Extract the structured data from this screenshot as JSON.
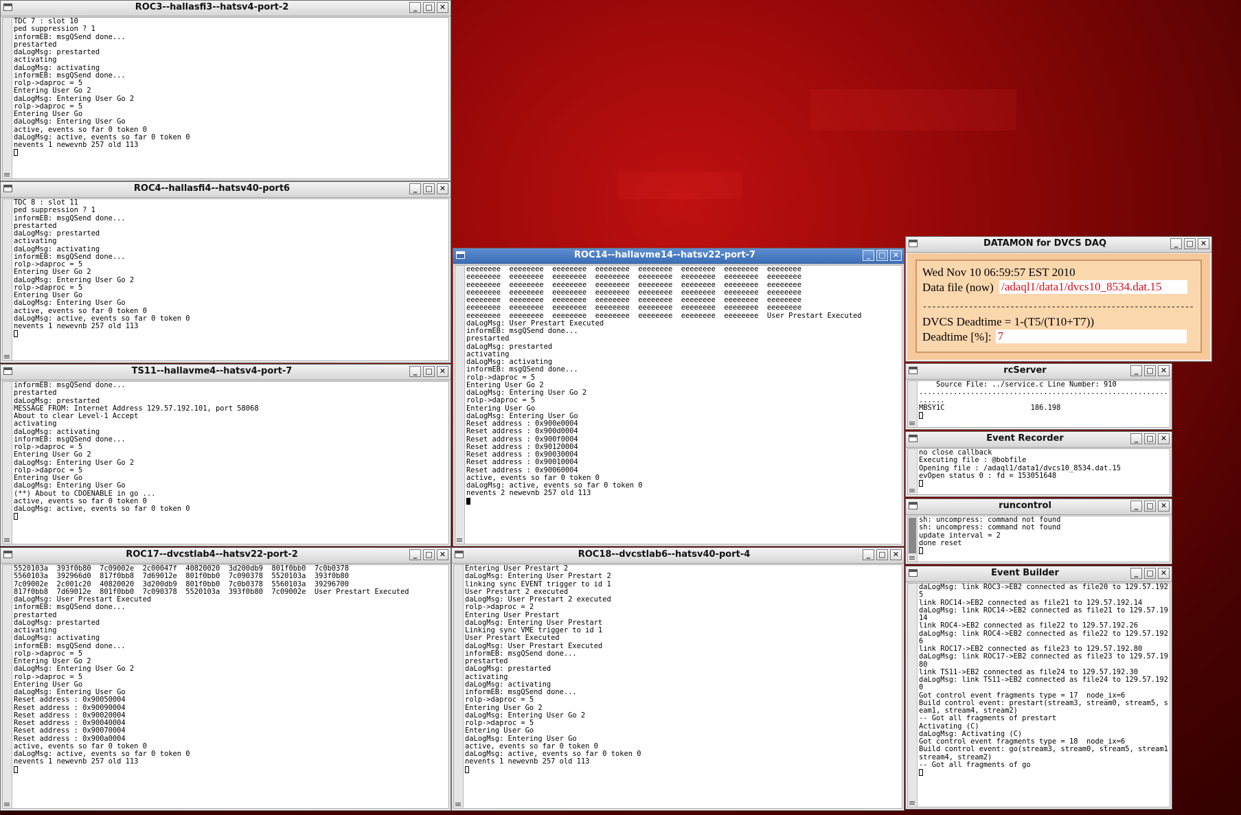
{
  "windows": {
    "roc3": {
      "title": "ROC3--hallasfi3--hatsv4-port-2",
      "lines": [
        "TDC 7 : slot 10",
        "ped suppression ? 1",
        "informEB: msgQSend done...",
        "prestarted",
        "daLogMsg: prestarted",
        "activating",
        "daLogMsg: activating",
        "informEB: msgQSend done...",
        "rolp->daproc = 5",
        "Entering User Go 2",
        "daLogMsg: Entering User Go 2",
        "rolp->daproc = 5",
        "Entering User Go",
        "daLogMsg: Entering User Go",
        "active, events so far 0 token 0",
        "daLogMsg: active, events so far 0 token 0",
        "nevents 1 newevnb 257 old 113"
      ]
    },
    "roc4": {
      "title": "ROC4--hallasfi4--hatsv40-port6",
      "lines": [
        "TDC 8 : slot 11",
        "ped suppression ? 1",
        "informEB: msgQSend done...",
        "prestarted",
        "daLogMsg: prestarted",
        "activating",
        "daLogMsg: activating",
        "informEB: msgQSend done...",
        "rolp->daproc = 5",
        "Entering User Go 2",
        "daLogMsg: Entering User Go 2",
        "rolp->daproc = 5",
        "Entering User Go",
        "daLogMsg: Entering User Go",
        "active, events so far 0 token 0",
        "daLogMsg: active, events so far 0 token 0",
        "nevents 1 newevnb 257 old 113"
      ]
    },
    "ts11": {
      "title": "TS11--hallavme4--hatsv4-port-7",
      "lines": [
        "informEB: msgQSend done...",
        "prestarted",
        "daLogMsg: prestarted",
        "MESSAGE FROM: Internet Address 129.57.192.101, port 58068",
        "About to clear Level-1 Accept",
        "activating",
        "daLogMsg: activating",
        "informEB: msgQSend done...",
        "rolp->daproc = 5",
        "Entering User Go 2",
        "daLogMsg: Entering User Go 2",
        "rolp->daproc = 5",
        "Entering User Go",
        "daLogMsg: Entering User Go",
        "(**) About to CDOENABLE in go ...",
        "active, events so far 0 token 0",
        "daLogMsg: active, events so far 0 token 0"
      ]
    },
    "roc17": {
      "title": "ROC17--dvcstlab4--hatsv22-port-2",
      "lines": [
        "5520103a  393f0b80  7c09002e  2c00047f  40820020  3d200db9  801f0bb0  7c0b0378",
        "5560103a  392966d0  817f0bb8  7d69012e  801f0bb0  7c090378  5520103a  393f0b80",
        "7c09002e  2c001c20  40820020  3d200db9  801f0bb0  7c0b0378  5560103a  39296700",
        "817f0bb8  7d69012e  801f0bb0  7c090378  5520103a  393f0b80  7c09002e  User Prestart Executed",
        "daLogMsg: User Prestart Executed",
        "informEB: msgQSend done...",
        "prestarted",
        "daLogMsg: prestarted",
        "activating",
        "daLogMsg: activating",
        "informEB: msgQSend done...",
        "rolp->daproc = 5",
        "Entering User Go 2",
        "daLogMsg: Entering User Go 2",
        "rolp->daproc = 5",
        "Entering User Go",
        "daLogMsg: Entering User Go",
        "Reset address : 0x90050004",
        "Reset address : 0x90090004",
        "Reset address : 0x90020004",
        "Reset address : 0x90040004",
        "Reset address : 0x90070004",
        "Reset address : 0x900a0004",
        "active, events so far 0 token 0",
        "daLogMsg: active, events so far 0 token 0",
        "nevents 1 newevnb 257 old 113"
      ]
    },
    "roc14": {
      "title": "ROC14--hallavme14--hatsv22-port-7",
      "lines": [
        "eeeeeeee  eeeeeeee  eeeeeeee  eeeeeeee  eeeeeeee  eeeeeeee  eeeeeeee  eeeeeeee",
        "eeeeeeee  eeeeeeee  eeeeeeee  eeeeeeee  eeeeeeee  eeeeeeee  eeeeeeee  eeeeeeee",
        "eeeeeeee  eeeeeeee  eeeeeeee  eeeeeeee  eeeeeeee  eeeeeeee  eeeeeeee  eeeeeeee",
        "eeeeeeee  eeeeeeee  eeeeeeee  eeeeeeee  eeeeeeee  eeeeeeee  eeeeeeee  eeeeeeee",
        "eeeeeeee  eeeeeeee  eeeeeeee  eeeeeeee  eeeeeeee  eeeeeeee  eeeeeeee  eeeeeeee",
        "eeeeeeee  eeeeeeee  eeeeeeee  eeeeeeee  eeeeeeee  eeeeeeee  eeeeeeee  eeeeeeee",
        "eeeeeeee  eeeeeeee  eeeeeeee  eeeeeeee  eeeeeeee  eeeeeeee  eeeeeeee  User Prestart Executed",
        "daLogMsg: User Prestart Executed",
        "informEB: msgQSend done...",
        "prestarted",
        "daLogMsg: prestarted",
        "activating",
        "daLogMsg: activating",
        "informEB: msgQSend done...",
        "rolp->daproc = 5",
        "Entering User Go 2",
        "daLogMsg: Entering User Go 2",
        "rolp->daproc = 5",
        "Entering User Go",
        "daLogMsg: Entering User Go",
        "Reset address : 0x900e0004",
        "Reset address : 0x900d0004",
        "Reset address : 0x900f0004",
        "Reset address : 0x90120004",
        "Reset address : 0x90030004",
        "Reset address : 0x90010004",
        "Reset address : 0x90060004",
        "active, events so far 0 token 0",
        "daLogMsg: active, events so far 0 token 0",
        "nevents 2 newevnb 257 old 113"
      ]
    },
    "roc18": {
      "title": "ROC18--dvcstlab6--hatsv40-port-4",
      "lines": [
        "Entering User Prestart 2",
        "daLogMsg: Entering User Prestart 2",
        "linking sync EVENT trigger to id 1",
        "User Prestart 2 executed",
        "daLogMsg: User Prestart 2 executed",
        "rolp->daproc = 2",
        "Entering User Prestart",
        "daLogMsg: Entering User Prestart",
        "Linking sync VME trigger to id 1",
        "User Prestart Executed",
        "daLogMsg: User Prestart Executed",
        "informEB: msgQSend done...",
        "prestarted",
        "daLogMsg: prestarted",
        "activating",
        "daLogMsg: activating",
        "informEB: msgQSend done...",
        "rolp->daproc = 5",
        "Entering User Go 2",
        "daLogMsg: Entering User Go 2",
        "rolp->daproc = 5",
        "Entering User Go",
        "daLogMsg: Entering User Go",
        "active, events so far 0 token 0",
        "daLogMsg: active, events so far 0 token 0",
        "nevents 1 newevnb 257 old 113"
      ]
    },
    "datamon": {
      "title": "DATAMON  for DVCS DAQ",
      "date": "Wed Nov 10 06:59:57 EST 2010",
      "datafile_label": "Data file (now)",
      "datafile_value": "/adaql1/data1/dvcs10_8534.dat.15",
      "separator": "--------------------------------------------------------------------------",
      "deadtime_formula": "DVCS Deadtime = 1-(T5/(T10+T7))",
      "deadtime_label": "Deadtime [%]:",
      "deadtime_value": "7"
    },
    "rcserver": {
      "title": "rcServer",
      "lines": [
        "    Source File: ../service.c Line Number: 910",
        "...................................................................",
        "......",
        "MBSY1C                    186.198"
      ]
    },
    "eventrecorder": {
      "title": "Event Recorder",
      "lines": [
        "no close callback",
        "Executing file : @bobfile",
        "Opening file : /adaql1/data1/dvcs10_8534.dat.15",
        "evOpen status 0 : fd = 153051648"
      ]
    },
    "runcontrol": {
      "title": "runcontrol",
      "lines": [
        "sh: uncompress: command not found",
        "sh: uncompress: command not found",
        "update interval = 2",
        "done reset"
      ]
    },
    "eventbuilder": {
      "title": "Event Builder",
      "lines": [
        "daLogMsg: link ROC3->EB2 connected as file20 to 129.57.192.2",
        "5",
        "link ROC14->EB2 connected as file21 to 129.57.192.14",
        "daLogMsg: link ROC14->EB2 connected as file21 to 129.57.192.",
        "14",
        "link ROC4->EB2 connected as file22 to 129.57.192.26",
        "daLogMsg: link ROC4->EB2 connected as file22 to 129.57.192.2",
        "6",
        "link ROC17->EB2 connected as file23 to 129.57.192.80",
        "daLogMsg: link ROC17->EB2 connected as file23 to 129.57.192.",
        "80",
        "link TS11->EB2 connected as file24 to 129.57.192.30",
        "daLogMsg: link TS11->EB2 connected as file24 to 129.57.192.3",
        "0",
        "Got control event fragments type = 17  node_ix=6",
        "Build control event: prestart(stream3, stream0, stream5, str",
        "eam1, stream4, stream2)",
        "-- Got all fragments of prestart",
        "Activating (C)",
        "daLogMsg: Activating (C)",
        "Got control event fragments type = 18  node_ix=6",
        "Build control event: go(stream3, stream0, stream5, stream1,",
        "stream4, stream2)",
        "-- Got all fragments of go"
      ]
    }
  },
  "buttons": {
    "minimize": "_",
    "maximize": "□",
    "close": "✕"
  }
}
